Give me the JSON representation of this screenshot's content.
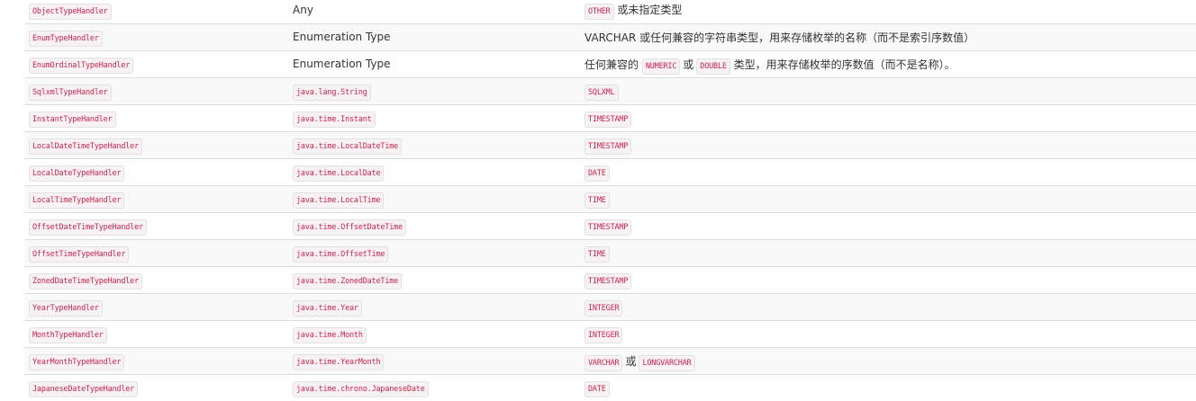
{
  "rows": [
    {
      "handler": "ObjectTypeHandler",
      "java_type": "Any",
      "jdbc_code": "OTHER",
      "jdbc_text": "或未指定类型"
    },
    {
      "handler": "EnumTypeHandler",
      "java_type": "Enumeration Type",
      "jdbc_text": "VARCHAR 或任何兼容的字符串类型，用来存储枚举的名称（而不是索引序数值）"
    },
    {
      "handler": "EnumOrdinalTypeHandler",
      "java_type": "Enumeration Type",
      "jdbc_prefix": "任何兼容的",
      "jdbc_code_1": "NUMERIC",
      "jdbc_or": "或",
      "jdbc_code_2": "DOUBLE",
      "jdbc_suffix": "类型，用来存储枚举的序数值（而不是名称）。"
    },
    {
      "handler": "SqlxmlTypeHandler",
      "java_type": "java.lang.String",
      "jdbc_code": "SQLXML"
    },
    {
      "handler": "InstantTypeHandler",
      "java_type": "java.time.Instant",
      "jdbc_code": "TIMESTAMP"
    },
    {
      "handler": "LocalDateTimeTypeHandler",
      "java_type": "java.time.LocalDateTime",
      "jdbc_code": "TIMESTAMP"
    },
    {
      "handler": "LocalDateTypeHandler",
      "java_type": "java.time.LocalDate",
      "jdbc_code": "DATE"
    },
    {
      "handler": "LocalTimeTypeHandler",
      "java_type": "java.time.LocalTime",
      "jdbc_code": "TIME"
    },
    {
      "handler": "OffsetDateTimeTypeHandler",
      "java_type": "java.time.OffsetDateTime",
      "jdbc_code": "TIMESTAMP"
    },
    {
      "handler": "OffsetTimeTypeHandler",
      "java_type": "java.time.OffsetTime",
      "jdbc_code": "TIME"
    },
    {
      "handler": "ZonedDateTimeTypeHandler",
      "java_type": "java.time.ZonedDateTime",
      "jdbc_code": "TIMESTAMP"
    },
    {
      "handler": "YearTypeHandler",
      "java_type": "java.time.Year",
      "jdbc_code": "INTEGER"
    },
    {
      "handler": "MonthTypeHandler",
      "java_type": "java.time.Month",
      "jdbc_code": "INTEGER"
    },
    {
      "handler": "YearMonthTypeHandler",
      "java_type": "java.time.YearMonth",
      "jdbc_code_1": "VARCHAR",
      "jdbc_or": "或",
      "jdbc_code_2": "LONGVARCHAR"
    },
    {
      "handler": "JapaneseDateTypeHandler",
      "java_type": "java.time.chrono.JapaneseDate",
      "jdbc_code": "DATE"
    }
  ]
}
